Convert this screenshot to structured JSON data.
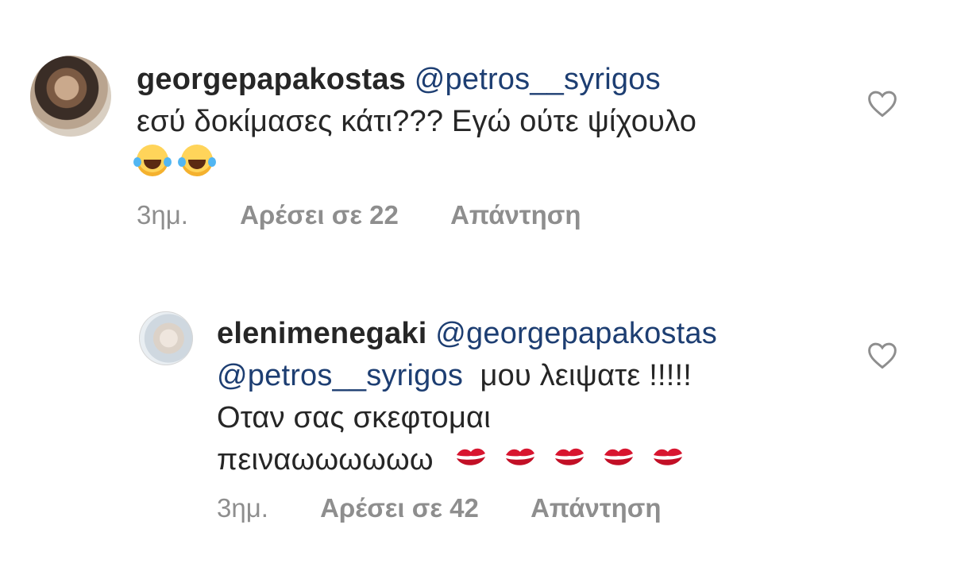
{
  "comments": [
    {
      "username": "georgepapakostas",
      "mentions": [
        "@petros__syrigos"
      ],
      "text": "εσύ δοκίμασες κάτι??? Εγώ ούτε ψίχουλο",
      "emoji": [
        "face-with-tears-of-joy",
        "face-with-tears-of-joy"
      ],
      "time": "3ημ.",
      "likes": "Αρέσει σε 22",
      "reply": "Απάντηση"
    },
    {
      "username": "elenimenegaki",
      "mentions": [
        "@georgepapakostas",
        "@petros__syrigos"
      ],
      "text_line1": "μου λειψατε !!!!!",
      "text_line2": "Οταν σας σκεφτομαι",
      "text_line3": "πειναωωωωωω",
      "emoji": [
        "kiss-mark",
        "kiss-mark",
        "kiss-mark",
        "kiss-mark",
        "kiss-mark"
      ],
      "time": "3ημ.",
      "likes": "Αρέσει σε 42",
      "reply": "Απάντηση"
    }
  ],
  "colors": {
    "mention": "#1d3e72",
    "meta": "#8e8e8e",
    "text": "#262626"
  }
}
